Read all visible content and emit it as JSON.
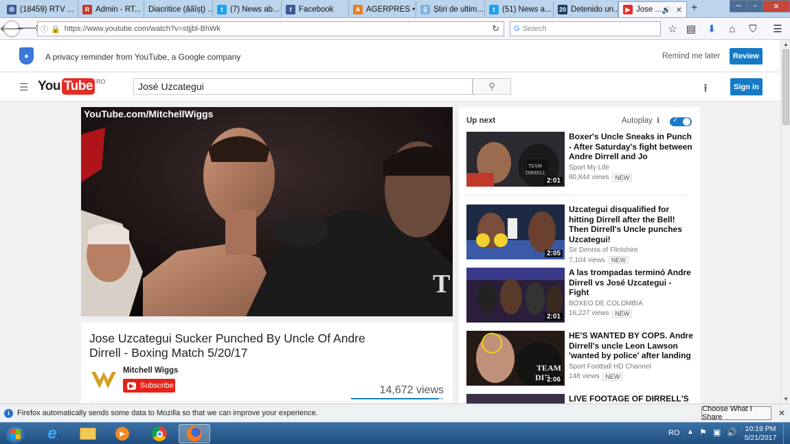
{
  "browser": {
    "tabs": [
      {
        "label": "(18459) RTV ...",
        "color": "#3b5998",
        "glyph": "◎"
      },
      {
        "label": "Admin - RT...",
        "color": "#c0392b",
        "glyph": "R"
      },
      {
        "label": "Diacritice (ăâîșț) ...",
        "color": "",
        "glyph": ""
      },
      {
        "label": "(7) News ab...",
        "color": "#1da1f2",
        "glyph": "t"
      },
      {
        "label": "Facebook",
        "color": "#3b5998",
        "glyph": "f"
      },
      {
        "label": "AGERPRES • ...",
        "color": "#e67e22",
        "glyph": "A"
      },
      {
        "label": "Știri de ultim...",
        "color": "#7fb3e0",
        "glyph": "Ș"
      },
      {
        "label": "(51) News a...",
        "color": "#1da1f2",
        "glyph": "t"
      },
      {
        "label": "Detenido un...",
        "color": "#1b3a5c",
        "glyph": "20"
      },
      {
        "label": "Jose ...",
        "color": "#e52d27",
        "glyph": "▶"
      }
    ],
    "url": "https://www.youtube.com/watch?v=stjjbl-BhWk",
    "search_placeholder": "Search"
  },
  "privacy": {
    "text": "A privacy reminder from YouTube, a Google company",
    "remind": "Remind me later",
    "review": "Review"
  },
  "header": {
    "logo_you": "You",
    "logo_tube": "Tube",
    "country": "RO",
    "search_value": "José Uzcategui",
    "signin": "Sign in"
  },
  "video": {
    "watermark": "YouTube.com/MitchellWiggs",
    "title": "Jose Uzcategui Sucker Punched By Uncle Of Andre Dirrell - Boxing Match 5/20/17",
    "channel": "Mitchell Wiggs",
    "subscribe": "Subscribe",
    "views": "14,672 views",
    "like_ratio": 0.95
  },
  "upnext": {
    "heading": "Up next",
    "autoplay": "Autoplay",
    "items": [
      {
        "title": "Boxer's Uncle Sneaks in Punch - After Saturday's fight between Andre Dirrell and Jo",
        "channel": "Sport My Life",
        "views": "80,844 views",
        "badge": "NEW",
        "duration": "2:01"
      },
      {
        "title": "Uzcategui disqualified for hitting Dirrell after the Bell! Then Dirrell's Uncle punches Uzcategui!",
        "channel": "Sir Dennis of Flintshire",
        "views": "7,104 views",
        "badge": "NEW",
        "duration": "2:05"
      },
      {
        "title": "A las trompadas terminó Andre Dirrell vs José Uzcategui - Fight",
        "channel": "BOXEO DE COLOMBIA",
        "views": "16,227 views",
        "badge": "NEW",
        "duration": "2:01"
      },
      {
        "title": "HE'S WANTED BY COPS. Andre Dirrell's uncle Leon Lawson 'wanted by police' after landing",
        "channel": "Sport Football HD Channel",
        "views": "148 views",
        "badge": "NEW",
        "duration": "2:06"
      },
      {
        "title": "LIVE FOOTAGE OF DIRRELL'S",
        "channel": "",
        "views": "",
        "badge": "",
        "duration": ""
      }
    ]
  },
  "notification": {
    "text": "Firefox automatically sends some data to Mozilla so that we can improve your experience.",
    "button": "Choose What I Share"
  },
  "taskbar": {
    "lang": "RO",
    "time": "10:19 PM",
    "date": "5/21/2017"
  }
}
